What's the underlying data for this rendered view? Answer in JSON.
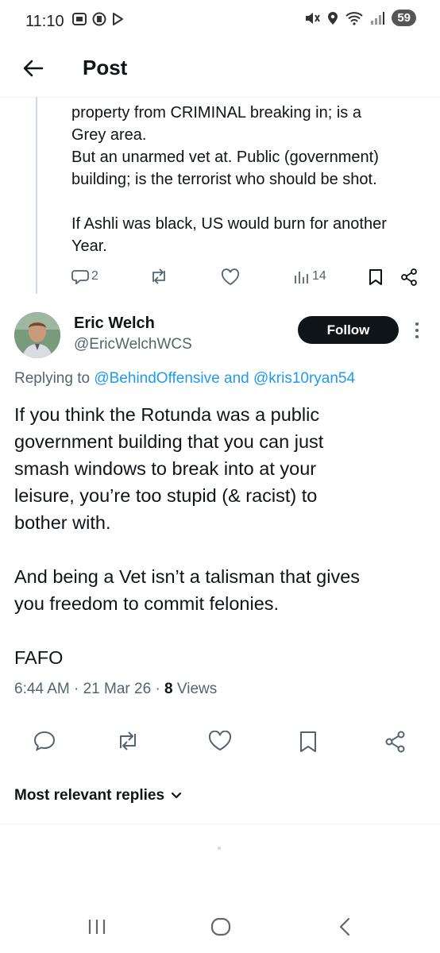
{
  "status_bar": {
    "time": "11:10",
    "battery": "59"
  },
  "header": {
    "title": "Post"
  },
  "previous_post": {
    "text": "property from CRIMINAL breaking in; is a\nGrey area.\nBut an unarmed vet at. Public (government)\nbuilding; is the terrorist who should be shot.\n\nIf Ashli was black, US would burn for another\nYear.",
    "reply_count": "2",
    "view_count": "14"
  },
  "post": {
    "author_name": "Eric Welch",
    "author_handle": "@EricWelchWCS",
    "follow_label": "Follow",
    "replying_prefix": "Replying to",
    "reply_to_1": "@BehindOffensive",
    "reply_and": "and",
    "reply_to_2": "@kris10ryan54",
    "text": "If you think the Rotunda was a public\ngovernment building that you can just\nsmash windows to break into at your\nleisure, you’re too stupid (& racist) to\nbother with.\n\nAnd being a Vet isn’t a talisman that gives\nyou freedom to commit felonies.\n\nFAFO",
    "time": "6:44 AM",
    "date": "21 Mar 26",
    "views_count": "8",
    "views_label": "Views"
  },
  "replies_sort": {
    "label": "Most relevant replies"
  },
  "colors": {
    "accent": "#1d9bf0",
    "text": "#0f1419",
    "secondary": "#536471"
  }
}
